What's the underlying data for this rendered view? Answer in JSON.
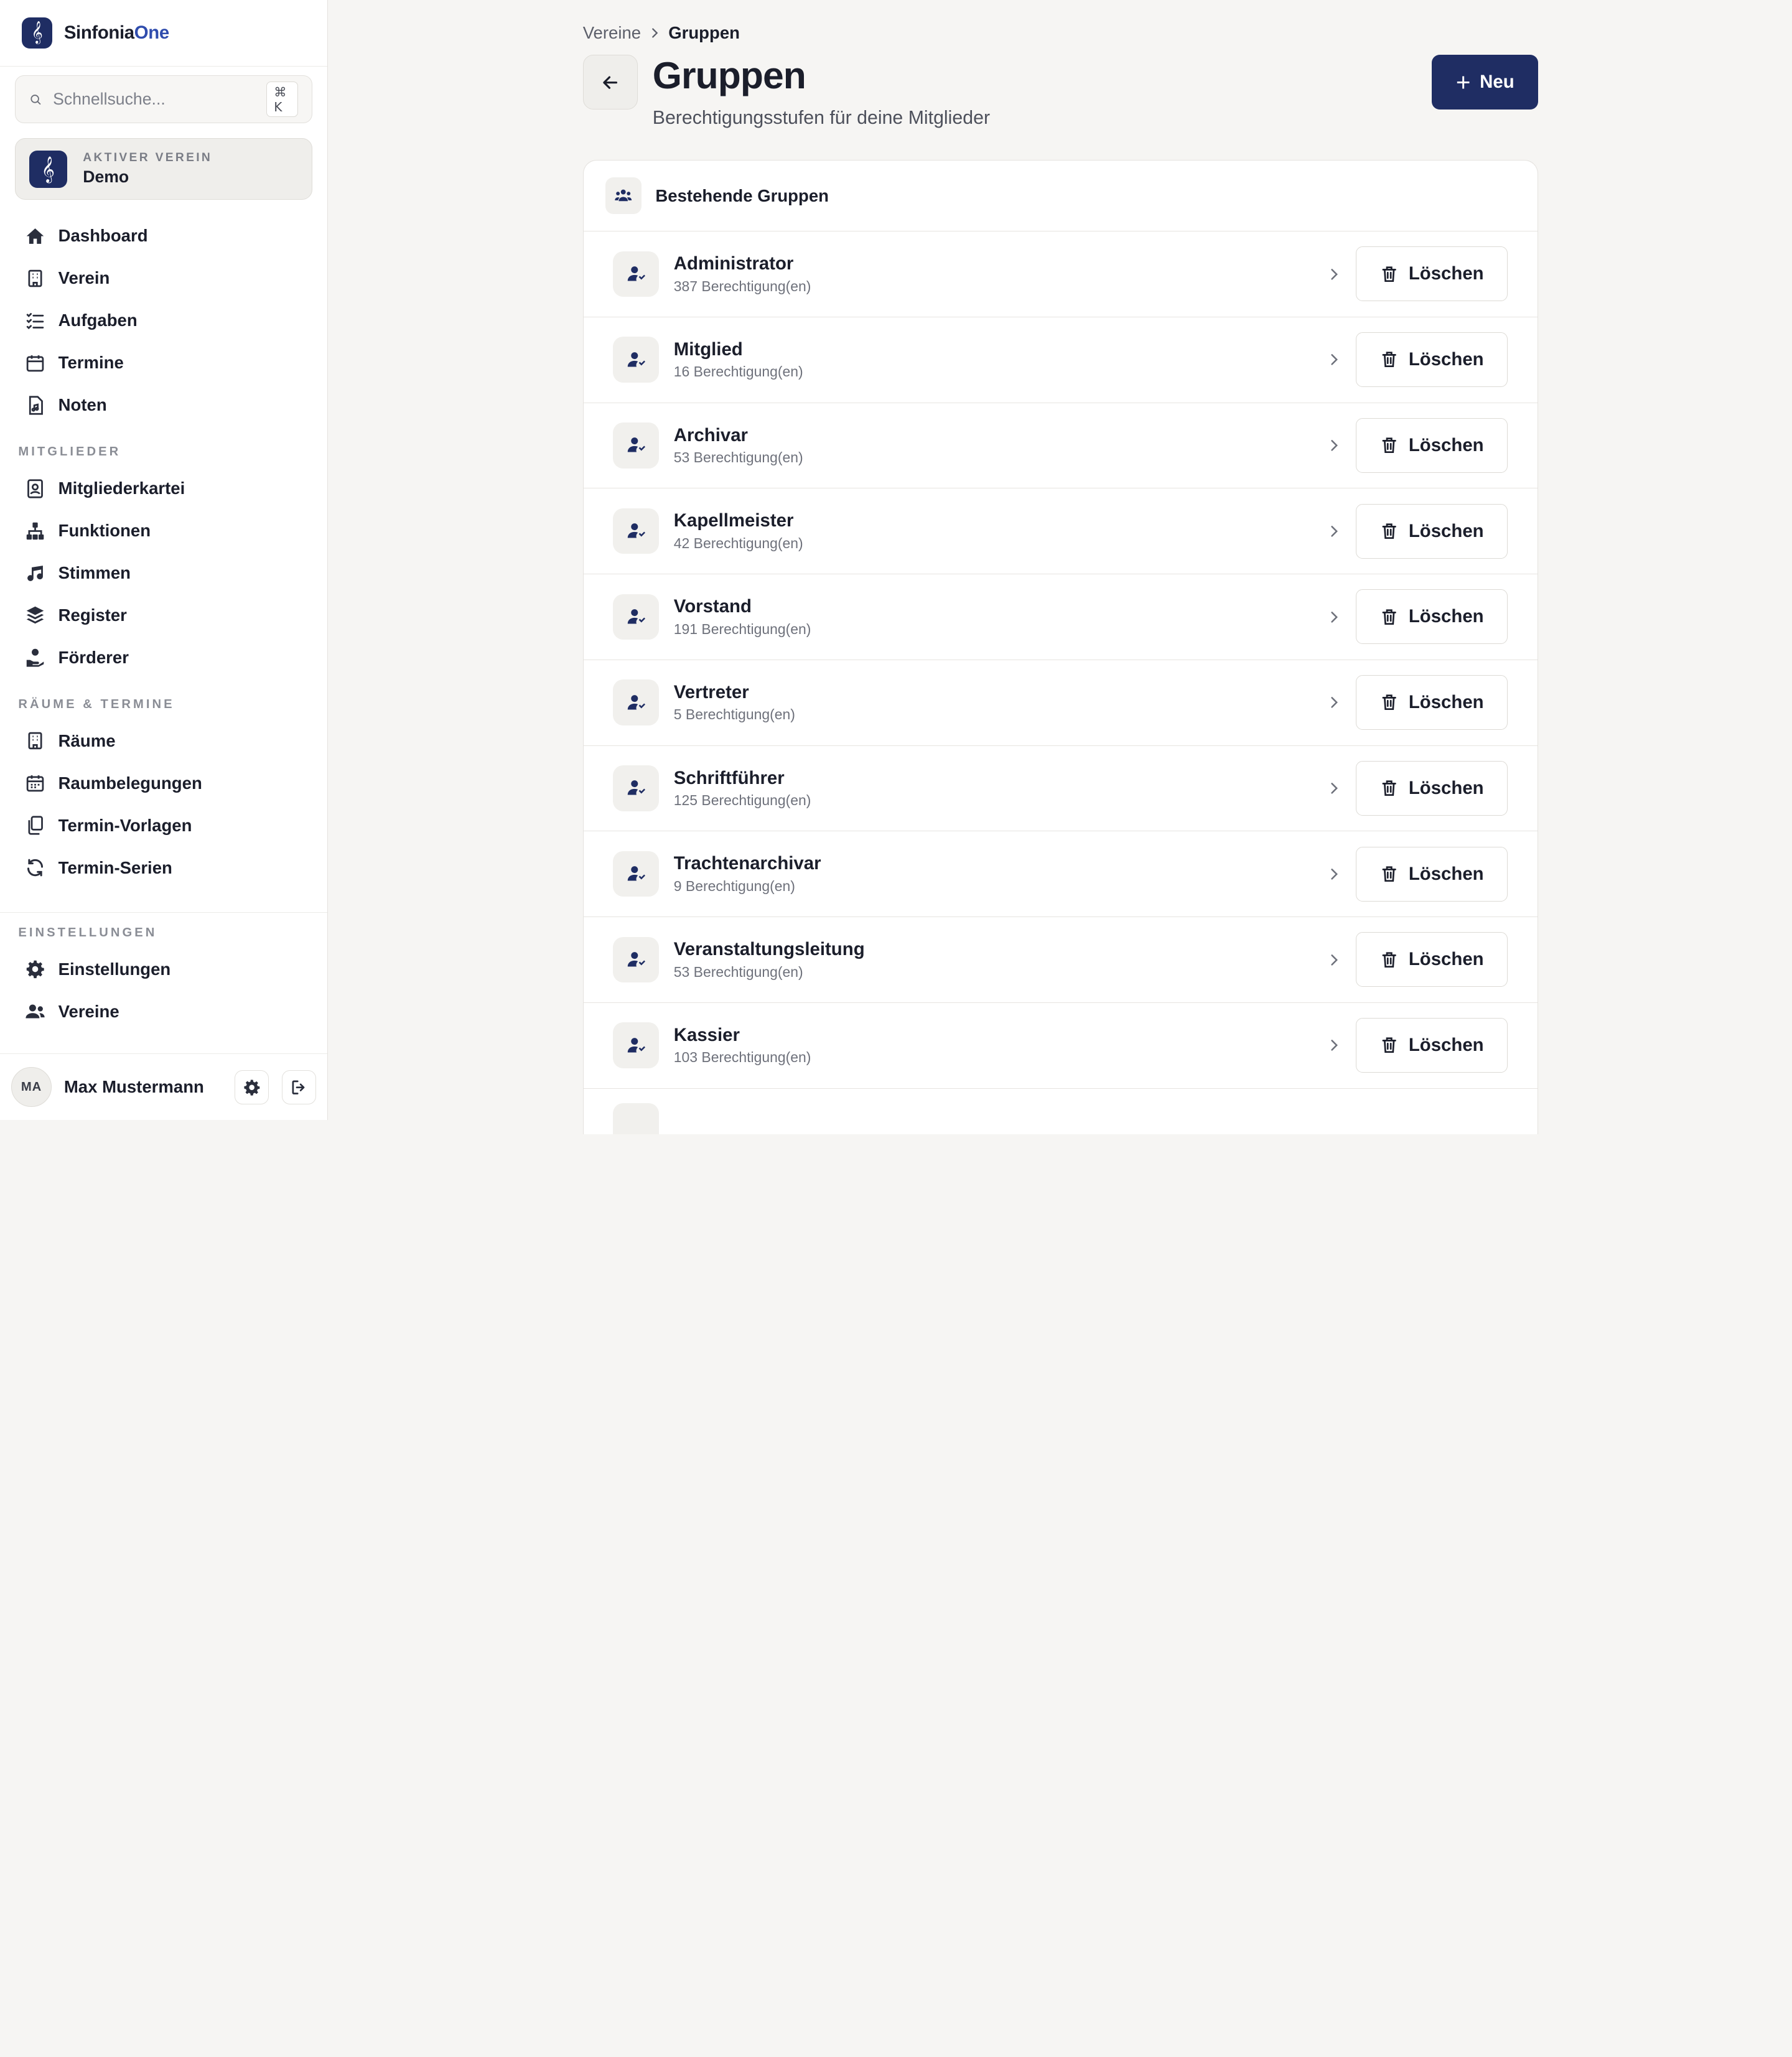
{
  "brand": {
    "name_main": "Sinfonia",
    "name_accent": "One",
    "logo_glyph": "𝄞"
  },
  "search": {
    "placeholder": "Schnellsuche...",
    "shortcut": "⌘ K"
  },
  "active_verein": {
    "overline": "AKTIVER VEREIN",
    "name": "Demo",
    "logo_glyph": "𝄞"
  },
  "nav": {
    "main": [
      {
        "label": "Dashboard",
        "icon": "home-icon"
      },
      {
        "label": "Verein",
        "icon": "building-icon"
      },
      {
        "label": "Aufgaben",
        "icon": "list-check-icon"
      },
      {
        "label": "Termine",
        "icon": "calendar-icon"
      },
      {
        "label": "Noten",
        "icon": "file-music-icon"
      }
    ],
    "mitglieder_section": "MITGLIEDER",
    "mitglieder": [
      {
        "label": "Mitgliederkartei",
        "icon": "id-card-icon"
      },
      {
        "label": "Funktionen",
        "icon": "sitemap-icon"
      },
      {
        "label": "Stimmen",
        "icon": "music-note-icon"
      },
      {
        "label": "Register",
        "icon": "layers-icon"
      },
      {
        "label": "Förderer",
        "icon": "hand-heart-icon"
      }
    ],
    "raeume_section": "RÄUME & TERMINE",
    "raeume": [
      {
        "label": "Räume",
        "icon": "building-icon"
      },
      {
        "label": "Raumbelegungen",
        "icon": "calendar-grid-icon"
      },
      {
        "label": "Termin-Vorlagen",
        "icon": "copy-icon"
      },
      {
        "label": "Termin-Serien",
        "icon": "refresh-icon"
      }
    ],
    "einstellungen_section": "EINSTELLUNGEN",
    "einstellungen": [
      {
        "label": "Einstellungen",
        "icon": "gear-icon"
      },
      {
        "label": "Vereine",
        "icon": "users-icon"
      }
    ]
  },
  "user": {
    "initials": "MA",
    "name": "Max Mustermann"
  },
  "breadcrumb": {
    "parent": "Vereine",
    "current": "Gruppen"
  },
  "page": {
    "title": "Gruppen",
    "subtitle": "Berechtigungsstufen für deine Mitglieder",
    "new_button": "Neu"
  },
  "groups_card": {
    "title": "Bestehende Gruppen",
    "delete_label": "Löschen",
    "rows": [
      {
        "name": "Administrator",
        "perms": "387 Berechtigung(en)"
      },
      {
        "name": "Mitglied",
        "perms": "16 Berechtigung(en)"
      },
      {
        "name": "Archivar",
        "perms": "53 Berechtigung(en)"
      },
      {
        "name": "Kapellmeister",
        "perms": "42 Berechtigung(en)"
      },
      {
        "name": "Vorstand",
        "perms": "191 Berechtigung(en)"
      },
      {
        "name": "Vertreter",
        "perms": "5 Berechtigung(en)"
      },
      {
        "name": "Schriftführer",
        "perms": "125 Berechtigung(en)"
      },
      {
        "name": "Trachtenarchivar",
        "perms": "9 Berechtigung(en)"
      },
      {
        "name": "Veranstaltungsleitung",
        "perms": "53 Berechtigung(en)"
      },
      {
        "name": "Kassier",
        "perms": "103 Berechtigung(en)"
      }
    ]
  },
  "colors": {
    "primary": "#1f2d63",
    "accent": "#2f4cad",
    "background": "#f6f5f3"
  }
}
